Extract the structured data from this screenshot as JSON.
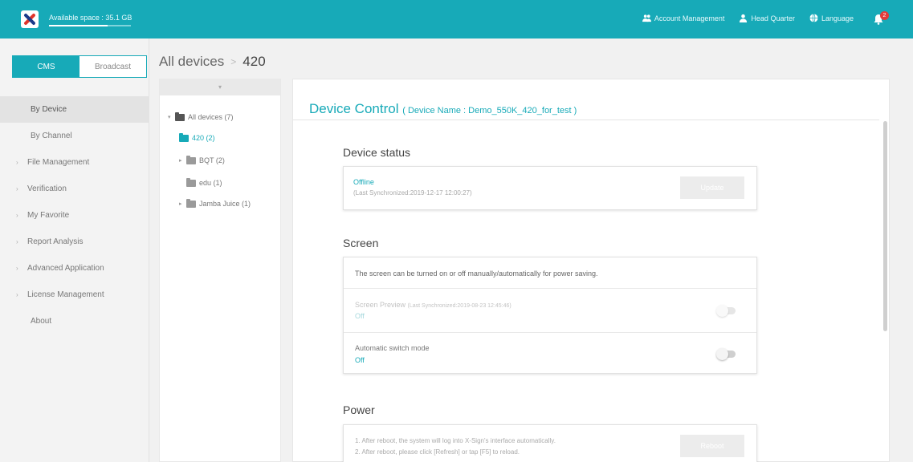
{
  "topbar": {
    "available_space": "Available space : 35.1 GB",
    "available_space_fraction": 0.72,
    "nav": [
      {
        "label": "Account Management",
        "icon": "users-icon"
      },
      {
        "label": "Head Quarter",
        "icon": "user-icon"
      },
      {
        "label": "Language",
        "icon": "globe-icon"
      }
    ],
    "notification_count": "2"
  },
  "sidebar": {
    "tabs": [
      "CMS",
      "Broadcast"
    ],
    "active_tab": "CMS",
    "items": [
      {
        "label": "By Device",
        "active": true
      },
      {
        "label": "By Channel"
      },
      {
        "label": "File Management",
        "expandable": true
      },
      {
        "label": "Verification",
        "expandable": true
      },
      {
        "label": "My Favorite",
        "expandable": true
      },
      {
        "label": "Report Analysis",
        "expandable": true
      },
      {
        "label": "Advanced Application",
        "expandable": true
      },
      {
        "label": "License Management",
        "expandable": true
      },
      {
        "label": "About"
      }
    ]
  },
  "breadcrumb": {
    "root": "All devices",
    "separator": ">",
    "current": "420"
  },
  "tree": {
    "collapse_glyph": "▾",
    "items": [
      {
        "label": "All devices (7)"
      },
      {
        "label": "420 (2)"
      },
      {
        "label": "BQT (2)"
      },
      {
        "label": "edu (1)"
      },
      {
        "label": "Jamba Juice (1)"
      }
    ]
  },
  "main": {
    "title": "Device Control",
    "device_name": "( Device Name : Demo_550K_420_for_test )",
    "device_status": {
      "title": "Device status",
      "status": "Offline",
      "last_sync": "(Last Synchronized:2019-12-17 12:00:27)",
      "button": "Update"
    },
    "screen": {
      "title": "Screen",
      "description": "The screen can be turned on or off manually/automatically for power saving.",
      "preview_label": "Screen Preview",
      "preview_sync": "(Last Synchronized:2019-08-23 12:45:46)",
      "preview_value": "Off",
      "auto_label": "Automatic switch mode",
      "auto_value": "Off"
    },
    "power": {
      "title": "Power",
      "note1": "1. After reboot, the system will log into X-Sign's interface automatically.",
      "note2": "2. After reboot, please click [Refresh] or tap [F5] to reload.",
      "button": "Reboot"
    }
  },
  "colors": {
    "accent": "#17aab8",
    "badge": "#e23b3b"
  }
}
